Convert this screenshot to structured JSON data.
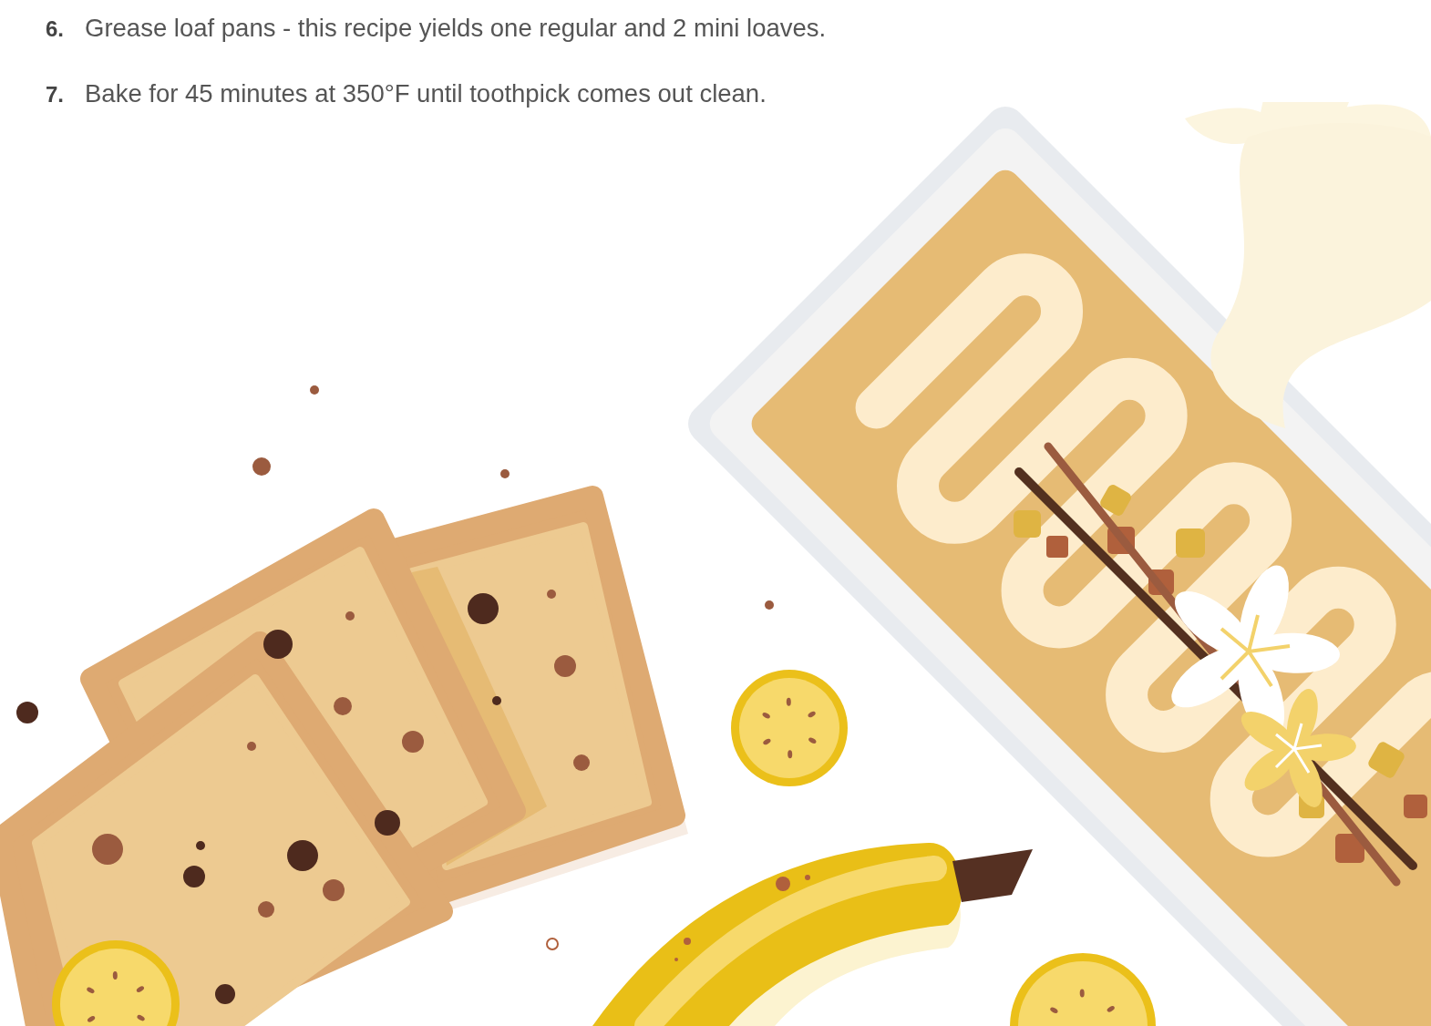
{
  "steps": [
    {
      "number": "6.",
      "text": "Grease loaf pans - this recipe yields one regular and 2 mini loaves."
    },
    {
      "number": "7.",
      "text": "Bake for 45 minutes at 350°F until toothpick comes out clean."
    }
  ]
}
